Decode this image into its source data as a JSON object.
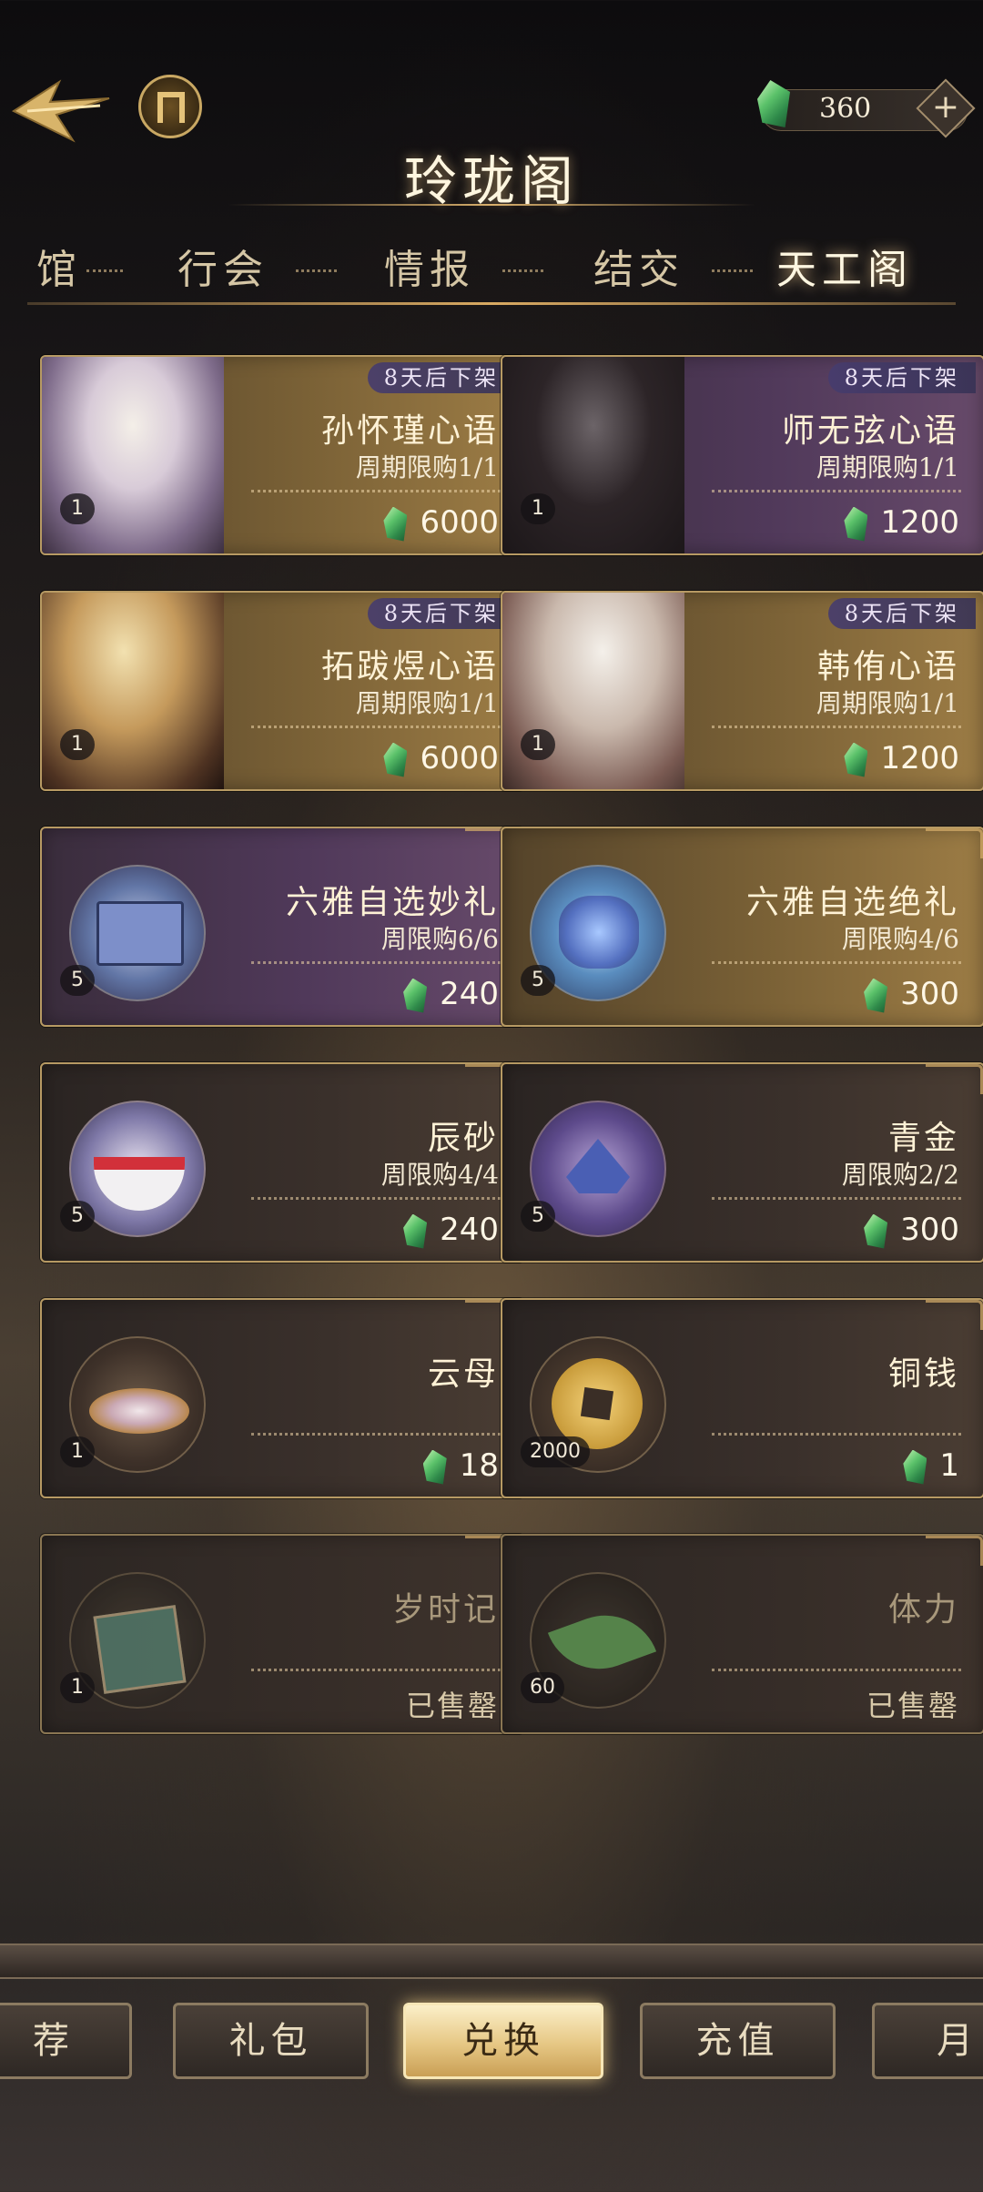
{
  "header": {
    "title": "玲珑阁",
    "currency_value": "360",
    "plus_symbol": "+"
  },
  "categories": [
    {
      "label": "馆"
    },
    {
      "label": "行会"
    },
    {
      "label": "情报"
    },
    {
      "label": "结交"
    },
    {
      "label": "天工阁"
    }
  ],
  "items": [
    {
      "name": "孙怀瑾心语",
      "limit": "周期限购1/1",
      "price": "6000",
      "qty": "1",
      "badge": "8天后下架"
    },
    {
      "name": "师无弦心语",
      "limit": "周期限购1/1",
      "price": "1200",
      "qty": "1",
      "badge": "8天后下架"
    },
    {
      "name": "拓跋煜心语",
      "limit": "周期限购1/1",
      "price": "6000",
      "qty": "1",
      "badge": "8天后下架"
    },
    {
      "name": "韩侑心语",
      "limit": "周期限购1/1",
      "price": "1200",
      "qty": "1",
      "badge": "8天后下架"
    },
    {
      "name": "六雅自选妙礼",
      "limit": "周限购6/6",
      "price": "240",
      "qty": "5"
    },
    {
      "name": "六雅自选绝礼",
      "limit": "周限购4/6",
      "price": "300",
      "qty": "5"
    },
    {
      "name": "辰砂",
      "limit": "周限购4/4",
      "price": "240",
      "qty": "5"
    },
    {
      "name": "青金",
      "limit": "周限购2/2",
      "price": "300",
      "qty": "5"
    },
    {
      "name": "云母",
      "price": "18",
      "qty": "1"
    },
    {
      "name": "铜钱",
      "price": "1",
      "qty": "2000"
    },
    {
      "name": "岁时记",
      "status": "已售罄",
      "qty": "1"
    },
    {
      "name": "体力",
      "status": "已售罄",
      "qty": "60"
    }
  ],
  "bottom_nav": [
    {
      "label": "荐"
    },
    {
      "label": "礼包"
    },
    {
      "label": "兑换"
    },
    {
      "label": "充值"
    },
    {
      "label": "月"
    }
  ]
}
